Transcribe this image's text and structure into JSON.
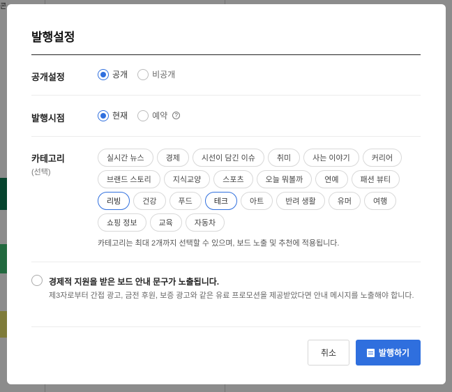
{
  "background": {
    "corner_text": "콘"
  },
  "modal": {
    "title": "발행설정",
    "visibility": {
      "label": "공개설정",
      "options": [
        {
          "label": "공개",
          "selected": true
        },
        {
          "label": "비공개",
          "selected": false
        }
      ]
    },
    "timing": {
      "label": "발행시점",
      "options": [
        {
          "label": "현재",
          "selected": true
        },
        {
          "label": "예약",
          "selected": false
        }
      ],
      "help": "?"
    },
    "category": {
      "label": "카테고리",
      "sub_label": "(선택)",
      "rows": [
        [
          "실시간 뉴스",
          "경제",
          "시선이 담긴 이슈",
          "취미",
          "사는 이야기",
          "커리어"
        ],
        [
          "브랜드 스토리",
          "지식교양",
          "스포츠",
          "오늘 뭐볼까",
          "연예",
          "패션 뷰티"
        ],
        [
          "리빙",
          "건강",
          "푸드",
          "테크",
          "아트",
          "반려 생활",
          "유머",
          "여행"
        ],
        [
          "쇼핑 정보",
          "교육",
          "자동차"
        ]
      ],
      "selected": [
        "리빙",
        "테크"
      ],
      "note": "카테고리는 최대 2개까지 선택할 수 있으며, 보드 노출 및 추천에 적용됩니다."
    },
    "notice": {
      "title": "경제적 지원을 받은 보드 안내 문구가 노출됩니다.",
      "description": "제3자로부터 간접 광고, 금전 후원, 보증 광고와 같은 유료 프로모션을 제공받았다면 안내 메시지를 노출해야 합니다."
    },
    "buttons": {
      "cancel": "취소",
      "publish": "발행하기"
    }
  }
}
